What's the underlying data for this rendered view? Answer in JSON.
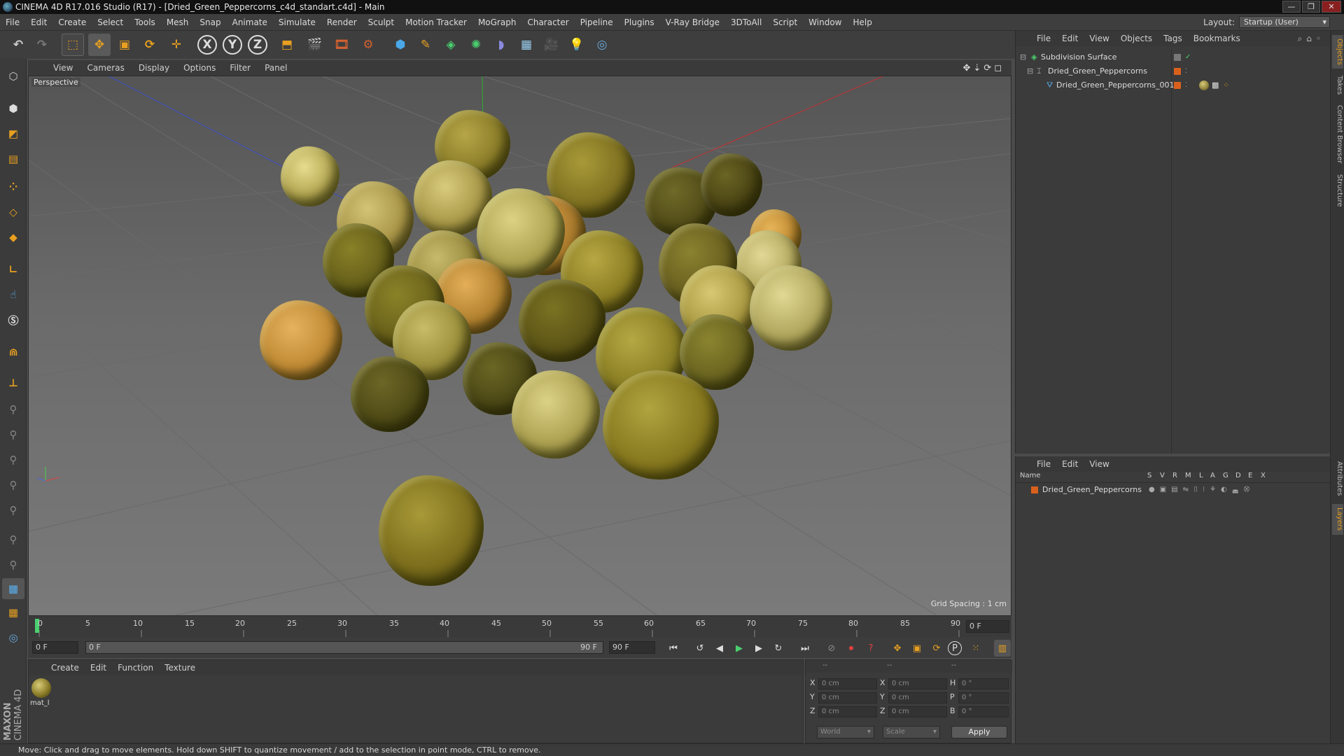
{
  "window": {
    "title": "CINEMA 4D R17.016 Studio (R17) - [Dried_Green_Peppercorns_c4d_standart.c4d] - Main",
    "min_label": "—",
    "max_label": "❐",
    "close_label": "✕"
  },
  "menu": {
    "items": [
      "File",
      "Edit",
      "Create",
      "Select",
      "Tools",
      "Mesh",
      "Snap",
      "Animate",
      "Simulate",
      "Render",
      "Sculpt",
      "Motion Tracker",
      "MoGraph",
      "Character",
      "Pipeline",
      "Plugins",
      "V-Ray Bridge",
      "3DToAll",
      "Script",
      "Window",
      "Help"
    ],
    "layout_label": "Layout:",
    "layout_value": "Startup (User)"
  },
  "toolbar": {
    "x_label": "X",
    "y_label": "Y",
    "z_label": "Z"
  },
  "viewport": {
    "menu": [
      "View",
      "Cameras",
      "Display",
      "Options",
      "Filter",
      "Panel"
    ],
    "camera_label": "Perspective",
    "grid_spacing": "Grid Spacing : 1 cm"
  },
  "timeline": {
    "ticks": [
      "0",
      "5",
      "10",
      "15",
      "20",
      "25",
      "30",
      "35",
      "40",
      "45",
      "50",
      "55",
      "60",
      "65",
      "70",
      "75",
      "80",
      "85",
      "90"
    ],
    "current_frame": "0 F",
    "start_frame": "0 F",
    "range_start": "0 F",
    "range_end": "90 F",
    "end_frame": "90 F"
  },
  "material_panel": {
    "menu": [
      "Create",
      "Edit",
      "Function",
      "Texture"
    ],
    "material_name": "mat_l"
  },
  "coordinates": {
    "header": [
      "--",
      "--",
      "--"
    ],
    "rows": [
      {
        "l1": "X",
        "v1": "0 cm",
        "l2": "X",
        "v2": "0 cm",
        "l3": "H",
        "v3": "0 °"
      },
      {
        "l1": "Y",
        "v1": "0 cm",
        "l2": "Y",
        "v2": "0 cm",
        "l3": "P",
        "v3": "0 °"
      },
      {
        "l1": "Z",
        "v1": "0 cm",
        "l2": "Z",
        "v2": "0 cm",
        "l3": "B",
        "v3": "0 °"
      }
    ],
    "space": "World",
    "mode": "Scale",
    "apply_label": "Apply"
  },
  "status": {
    "text": "Move: Click and drag to move elements. Hold down SHIFT to quantize movement / add to the selection in point mode, CTRL to remove."
  },
  "objects_panel": {
    "menu": [
      "File",
      "Edit",
      "View",
      "Objects",
      "Tags",
      "Bookmarks"
    ],
    "objects": [
      {
        "name": "Subdivision Surface"
      },
      {
        "name": "Dried_Green_Peppercorns"
      },
      {
        "name": "Dried_Green_Peppercorns_001"
      }
    ]
  },
  "layers_panel": {
    "menu": [
      "File",
      "Edit",
      "View"
    ],
    "columns": [
      "Name",
      "S",
      "V",
      "R",
      "M",
      "L",
      "A",
      "G",
      "D",
      "E",
      "X"
    ],
    "layers": [
      {
        "name": "Dried_Green_Peppercorns"
      }
    ]
  },
  "side_tabs": [
    "Objects",
    "Takes",
    "Content Browser",
    "Structure",
    "Attributes",
    "Layers"
  ],
  "brand": {
    "maxon": "MAXON",
    "product": "CINEMA 4D"
  },
  "colors": {
    "accent_orange": "#e8a020",
    "layer_orange": "#d9601c",
    "axis_x": "#c83030",
    "axis_y": "#30b030",
    "axis_z": "#3050c8"
  }
}
